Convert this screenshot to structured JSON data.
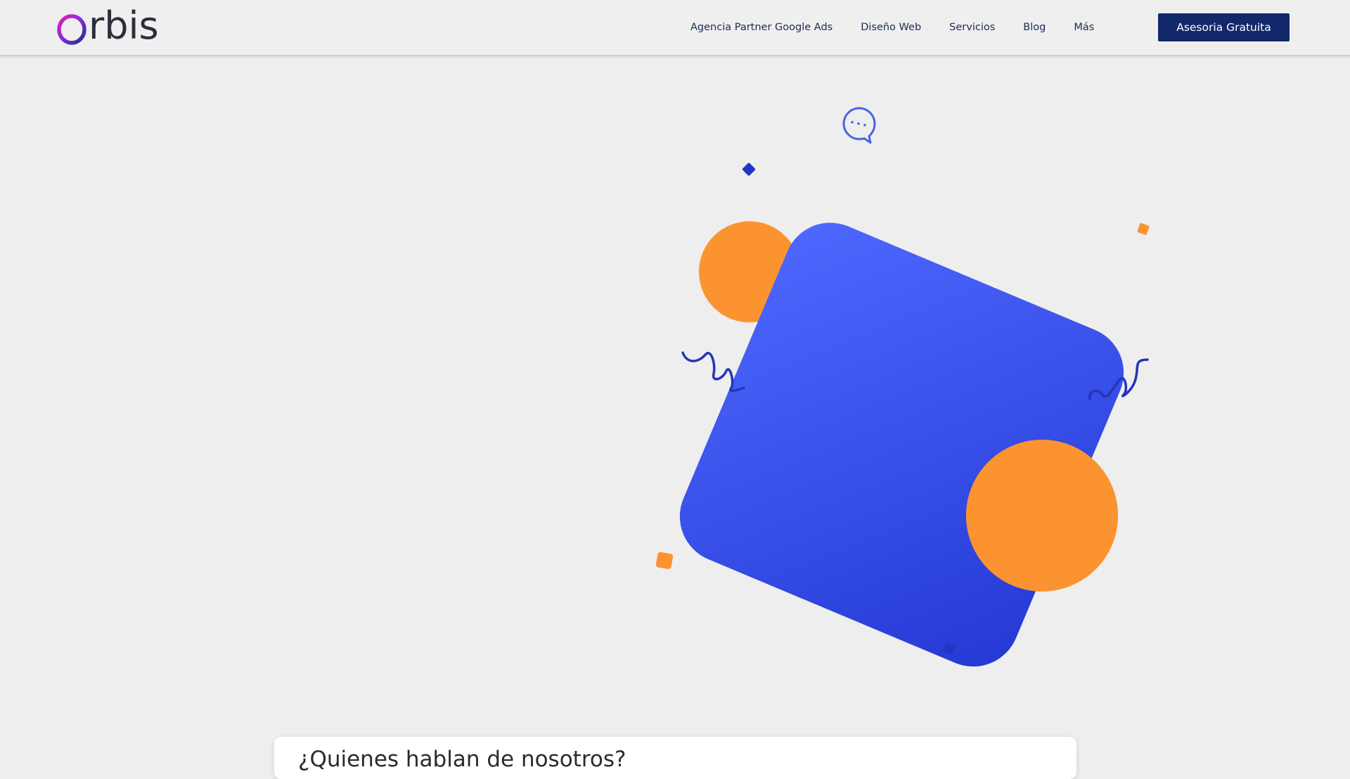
{
  "header": {
    "logo_text": "rbis",
    "nav": [
      {
        "label": "Agencia Partner Google Ads"
      },
      {
        "label": "Diseño Web"
      },
      {
        "label": "Servicios"
      },
      {
        "label": "Blog"
      },
      {
        "label": "Más"
      }
    ],
    "cta_label": "Asesoria Gratuita"
  },
  "press": {
    "title": "¿Quienes hablan de nosotros?"
  },
  "colors": {
    "brand_blue": "#13286b",
    "accent_blue": "#3a52e6",
    "accent_orange": "#fb9330",
    "nav_text": "#1c2b55"
  },
  "icons": [
    "logo-ring-icon",
    "chat-bubble-icon"
  ]
}
